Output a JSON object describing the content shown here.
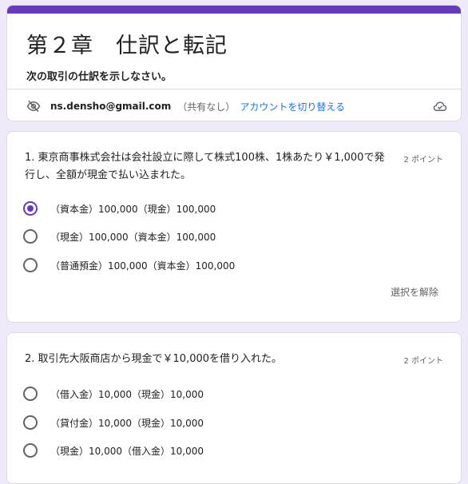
{
  "header": {
    "title": "第２章　仕訳と転記",
    "description": "次の取引の仕訳を示しなさい。",
    "email": "ns.densho@gmail.com",
    "shared_status": "（共有なし）",
    "switch_account": "アカウントを切り替える"
  },
  "accent_color": "#673ab7",
  "link_color": "#1a73e8",
  "questions": [
    {
      "text": "1.  東京商事株式会社は会社設立に際して株式100株、1株あたり￥1,000で発行し、全額が現金で払い込まれた。",
      "points": "2 ポイント",
      "options": [
        {
          "label": "（資本金）100,000（現金）100,000",
          "selected": true
        },
        {
          "label": "（現金）100,000（資本金）100,000",
          "selected": false
        },
        {
          "label": "（普通預金）100,000（資本金）100,000",
          "selected": false
        }
      ],
      "clear_label": "選択を解除"
    },
    {
      "text": "2.  取引先大阪商店から現金で￥10,000を借り入れた。",
      "points": "2 ポイント",
      "options": [
        {
          "label": "（借入金）10,000（現金）10,000",
          "selected": false
        },
        {
          "label": "（貸付金）10,000（現金）10,000",
          "selected": false
        },
        {
          "label": "（現金）10,000（借入金）10,000",
          "selected": false
        }
      ]
    }
  ]
}
